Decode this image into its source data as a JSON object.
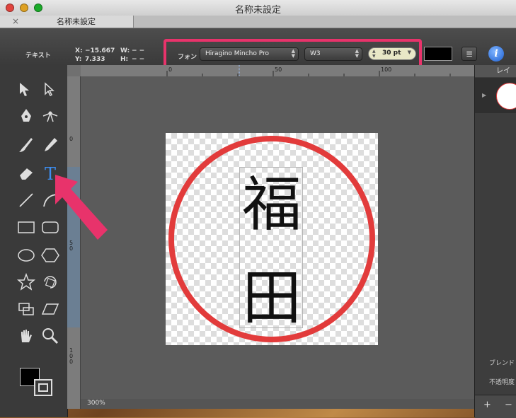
{
  "window": {
    "title": "名称未設定"
  },
  "tab": {
    "label": "名称未設定",
    "close_glyph": "×"
  },
  "toolbar": {
    "mode_label": "テキスト",
    "x_label": "X:",
    "x_value": "−15.667",
    "y_label": "Y:",
    "y_value": "7.333",
    "w_label": "W:",
    "w_value": "− −",
    "h_label": "H:",
    "h_value": "− −",
    "font_label": "フォン",
    "font_family": "Hiragino Mincho Pro",
    "font_weight": "W3",
    "font_size": "30 pt"
  },
  "ruler": {
    "h_ticks": [
      "0",
      "50",
      "100"
    ],
    "v_ticks": [
      "0",
      "5\n0",
      "1\n0\n0"
    ]
  },
  "canvas": {
    "char1": "福",
    "char2": "田",
    "zoom": "300%"
  },
  "layers": {
    "header": "レイヤ",
    "blend_label": "ブレンド",
    "opacity_label": "不透明度",
    "add_label": "+",
    "remove_label": "−"
  },
  "icons": {
    "tools": [
      "select-icon",
      "direct-select-icon",
      "pen-icon",
      "node-icon",
      "brush-icon",
      "pencil-icon",
      "eraser-icon",
      "text-tool-icon",
      "line-icon",
      "arc-icon",
      "rectangle-icon",
      "rounded-rect-icon",
      "ellipse-icon",
      "hexagon-icon",
      "star-icon",
      "rotate-icon",
      "frame-icon",
      "skew-icon",
      "hand-icon",
      "zoom-icon"
    ],
    "info": "info-icon"
  },
  "colors": {
    "accent_highlight": "#e8336b",
    "stamp_red": "#e23b3b",
    "text_tool_blue": "#3d8ef0"
  }
}
